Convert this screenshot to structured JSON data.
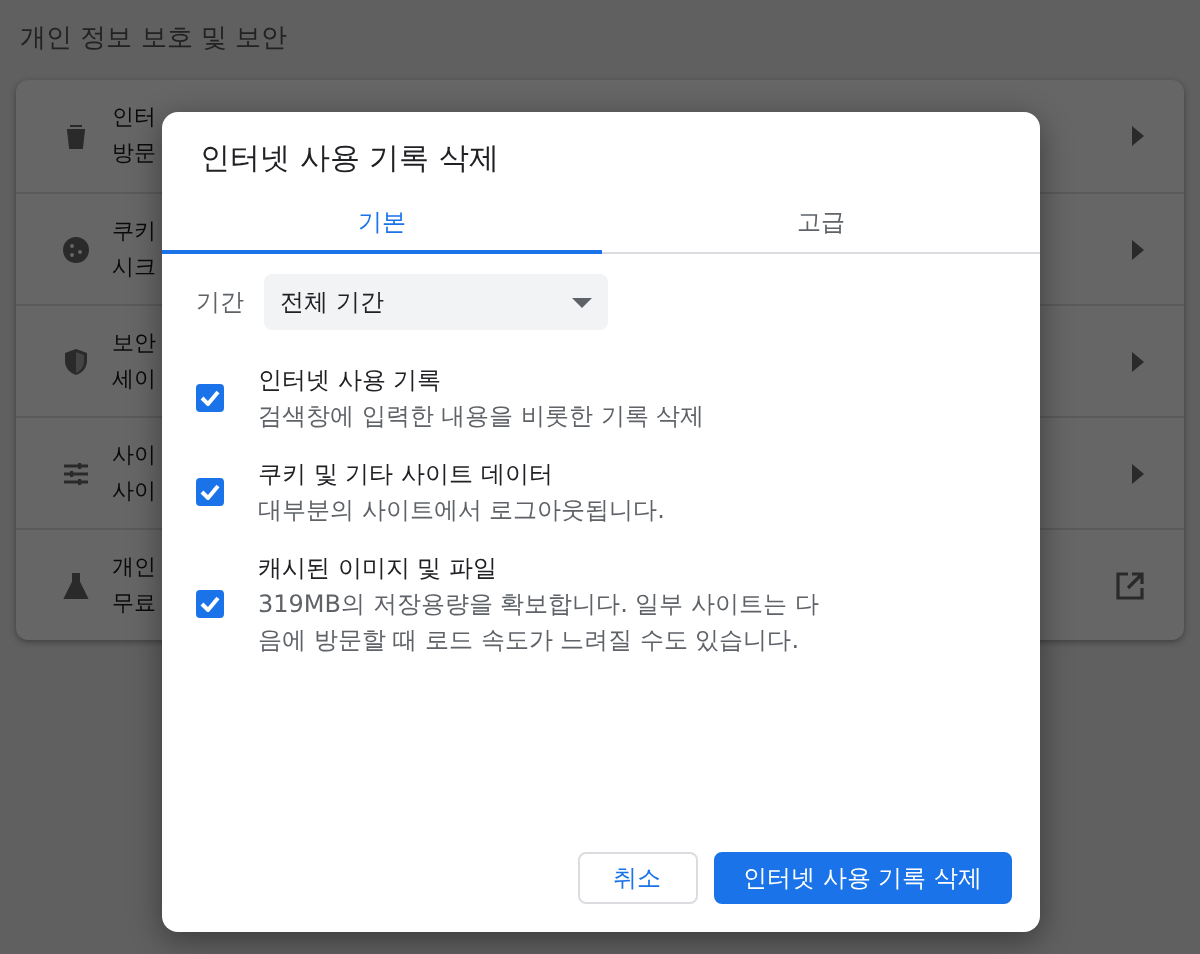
{
  "page": {
    "heading": "개인 정보 보호 및 보안"
  },
  "settings_rows": [
    {
      "title": "인터",
      "subtitle": "방문",
      "kind": "submenu"
    },
    {
      "title": "쿠키",
      "subtitle": "시크",
      "kind": "submenu"
    },
    {
      "title": "보안",
      "subtitle": "세이",
      "kind": "submenu"
    },
    {
      "title": "사이",
      "subtitle": "사이",
      "kind": "submenu"
    },
    {
      "title": "개인",
      "subtitle": "무료",
      "kind": "external"
    }
  ],
  "dialog": {
    "title": "인터넷 사용 기록 삭제",
    "tabs": [
      {
        "label": "기본",
        "selected": true
      },
      {
        "label": "고급",
        "selected": false
      }
    ],
    "period": {
      "label": "기간",
      "value": "전체 기간"
    },
    "options": [
      {
        "title": "인터넷 사용 기록",
        "description": "검색창에 입력한 내용을 비롯한 기록 삭제",
        "checked": true
      },
      {
        "title": "쿠키 및 기타 사이트 데이터",
        "description": "대부분의 사이트에서 로그아웃됩니다.",
        "checked": true
      },
      {
        "title": "캐시된 이미지 및 파일",
        "description": "319MB의 저장용량을 확보합니다. 일부 사이트는 다음에 방문할 때 로드 속도가 느려질 수도 있습니다.",
        "checked": true
      }
    ],
    "buttons": [
      {
        "label": "취소",
        "kind": "secondary"
      },
      {
        "label": "인터넷 사용 기록 삭제",
        "kind": "primary"
      }
    ]
  }
}
